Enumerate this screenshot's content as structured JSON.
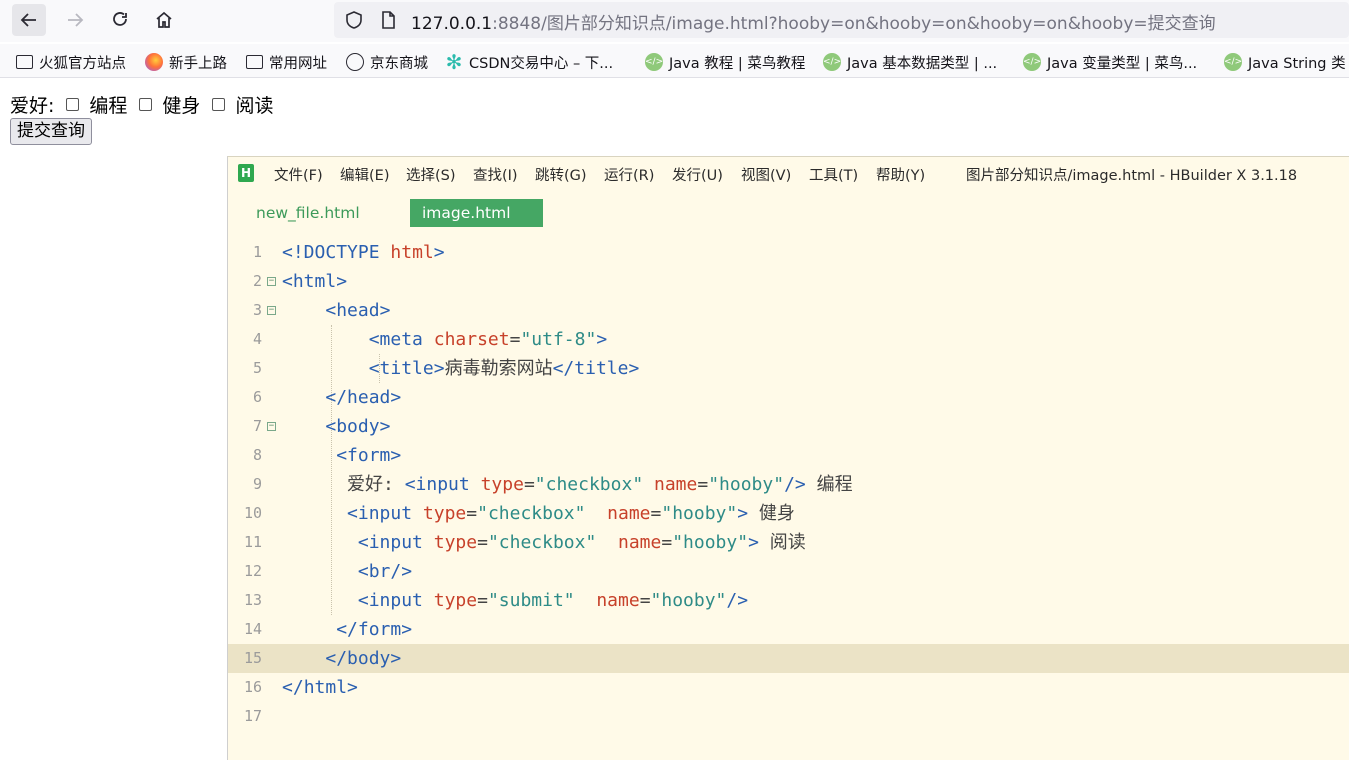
{
  "browser": {
    "url_host": "127.0.0.1",
    "url_rest": ":8848/图片部分知识点/image.html?hooby=on&hooby=on&hooby=on&hooby=提交查询"
  },
  "bookmarks": [
    {
      "label": "火狐官方站点",
      "icon": "folder-icon"
    },
    {
      "label": "新手上路",
      "icon": "firefox-icon"
    },
    {
      "label": "常用网址",
      "icon": "folder-icon"
    },
    {
      "label": "京东商城",
      "icon": "globe-icon"
    },
    {
      "label": "CSDN交易中心 – 下...",
      "icon": "csdn-icon"
    },
    {
      "label": "Java 教程 | 菜鸟教程",
      "icon": "runoob-icon"
    },
    {
      "label": "Java 基本数据类型 | ...",
      "icon": "runoob-icon"
    },
    {
      "label": "Java 变量类型 | 菜鸟...",
      "icon": "runoob-icon"
    },
    {
      "label": "Java String 类",
      "icon": "runoob-icon"
    }
  ],
  "form": {
    "label": "爱好:",
    "options": [
      "编程",
      "健身",
      "阅读"
    ],
    "submit_label": "提交查询"
  },
  "editor": {
    "logo": "H",
    "menu": [
      "文件(F)",
      "编辑(E)",
      "选择(S)",
      "查找(I)",
      "跳转(G)",
      "运行(R)",
      "发行(U)",
      "视图(V)",
      "工具(T)",
      "帮助(Y)"
    ],
    "title": "图片部分知识点/image.html - HBuilder X 3.1.18",
    "tabs": [
      "new_file.html",
      "image.html"
    ],
    "active_tab": "image.html",
    "current_line": 15,
    "lines": [
      {
        "n": "1",
        "fold": false,
        "text": "<!DOCTYPE html>"
      },
      {
        "n": "2",
        "fold": true,
        "text": "<html>"
      },
      {
        "n": "3",
        "fold": true,
        "text": "    <head>"
      },
      {
        "n": "4",
        "fold": false,
        "text": "        <meta charset=\"utf-8\">"
      },
      {
        "n": "5",
        "fold": false,
        "text": "        <title>病毒勒索网站</title>"
      },
      {
        "n": "6",
        "fold": false,
        "text": "    </head>"
      },
      {
        "n": "7",
        "fold": true,
        "text": "    <body>"
      },
      {
        "n": "8",
        "fold": false,
        "text": "     <form>"
      },
      {
        "n": "9",
        "fold": false,
        "text": "      爱好: <input type=\"checkbox\" name=\"hooby\"/> 编程"
      },
      {
        "n": "10",
        "fold": false,
        "text": "      <input type=\"checkbox\"  name=\"hooby\"> 健身"
      },
      {
        "n": "11",
        "fold": false,
        "text": "       <input type=\"checkbox\"  name=\"hooby\"> 阅读"
      },
      {
        "n": "12",
        "fold": false,
        "text": "       <br/>"
      },
      {
        "n": "13",
        "fold": false,
        "text": "       <input type=\"submit\"  name=\"hooby\"/>"
      },
      {
        "n": "14",
        "fold": false,
        "text": "     </form>"
      },
      {
        "n": "15",
        "fold": false,
        "text": "    </body>"
      },
      {
        "n": "16",
        "fold": false,
        "text": "</html>"
      },
      {
        "n": "17",
        "fold": false,
        "text": ""
      }
    ]
  }
}
